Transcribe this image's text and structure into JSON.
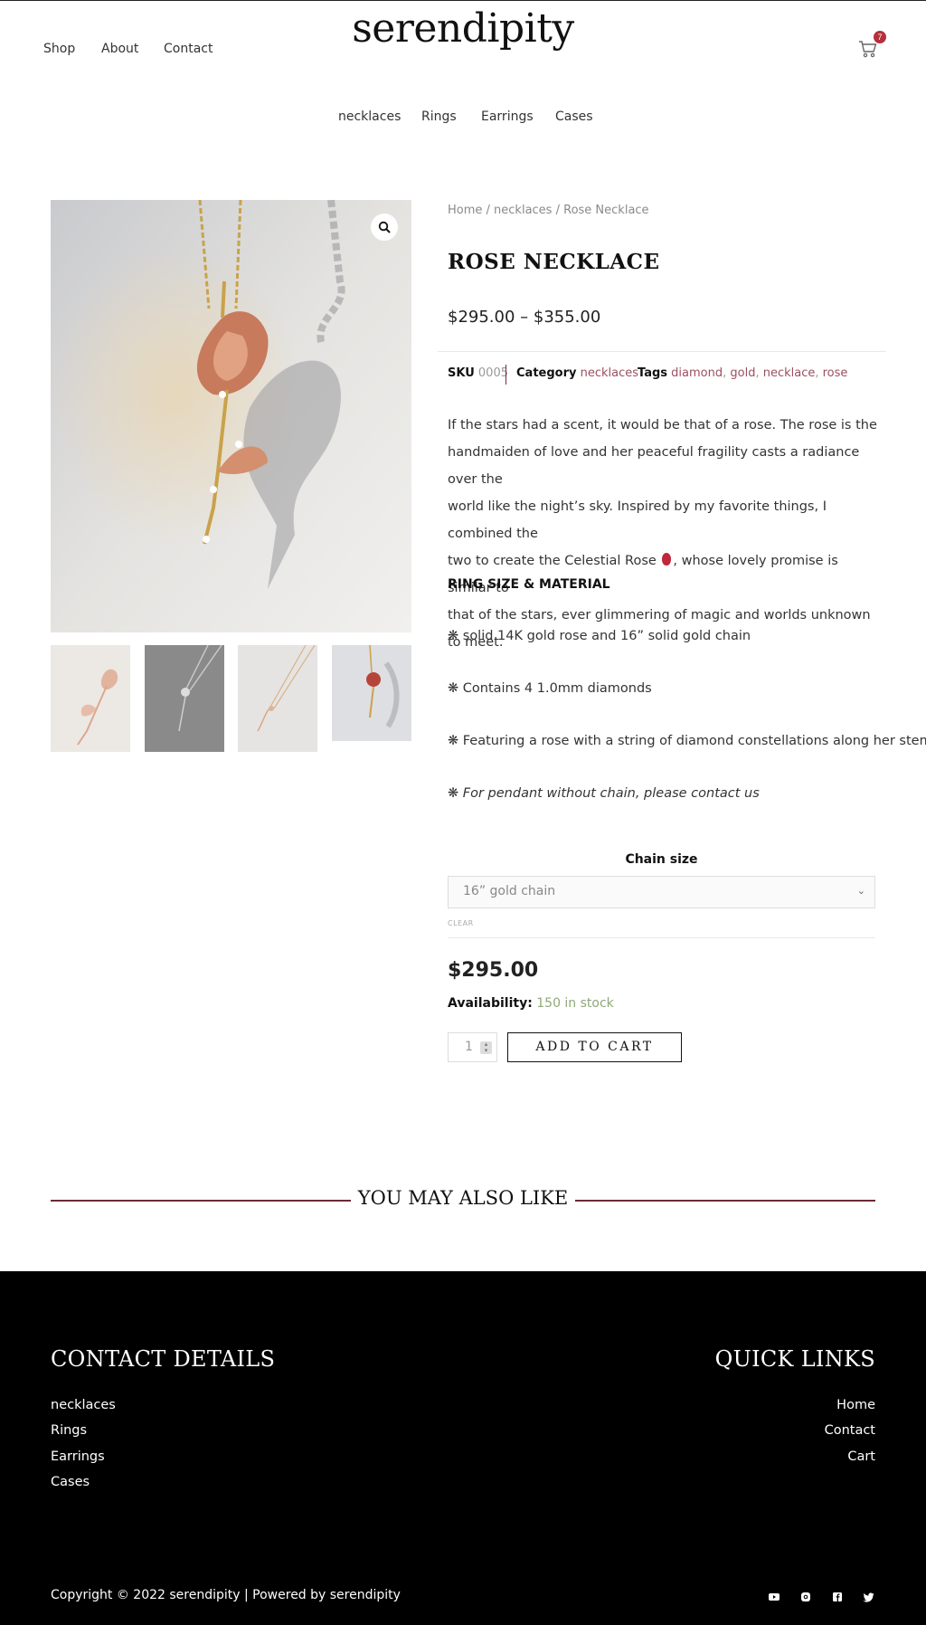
{
  "header": {
    "logo": "serendipity",
    "nav": [
      "Shop",
      "About",
      "Contact"
    ],
    "cart_count": "7",
    "categories": [
      "necklaces",
      "Rings",
      "Earrings",
      "Cases"
    ]
  },
  "breadcrumb": {
    "home": "Home",
    "sep1": " / ",
    "cat": "necklaces",
    "sep2": " / ",
    "current": "Rose Necklace"
  },
  "product": {
    "title": "ROSE NECKLACE",
    "price_range": "$295.00 – $355.00",
    "sku_label": "SKU",
    "sku": "0005",
    "category_label": "Category",
    "category": "necklaces",
    "tags_label": "Tags",
    "tags": [
      "diamond",
      "gold",
      "necklace",
      "rose"
    ],
    "description": [
      "If the stars had a scent, it would be that of a rose. The rose is the",
      "handmaiden of love and her peaceful fragility casts a radiance over the",
      "world like the night’s sky. Inspired by my favorite things, I combined the",
      "two to create the Celestial Rose",
      ", whose lovely promise is similar to",
      "that of the stars, ever glimmering of magic and worlds unknown to meet."
    ],
    "spec_heading": "RING SIZE & MATERIAL",
    "specs": [
      "❋ solid 14K gold rose and 16” solid gold chain",
      "❋ Contains 4 1.0mm diamonds",
      "❋ Featuring a rose with a string of diamond constellations along her stem"
    ],
    "spec_italic_prefix": "❋ ",
    "spec_italic": "For pendant without chain, please contact us",
    "chain_label": "Chain size",
    "chain_selected": "16” gold chain",
    "clear": "CLEAR",
    "variant_price": "$295.00",
    "availability_label": "Availability:",
    "availability": "150 in stock",
    "qty": "1",
    "add_to_cart": "ADD TO CART"
  },
  "also_like": "YOU MAY ALSO LIKE",
  "footer": {
    "contact_heading": "CONTACT DETAILS",
    "contact_links": [
      "necklaces",
      "Rings",
      "Earrings",
      "Cases"
    ],
    "quick_heading": "QUICK LINKS",
    "quick_links": [
      "Home",
      "Contact",
      "Cart"
    ],
    "copyright": "Copyright © 2022 serendipity | Powered by serendipity",
    "social_icons": [
      "youtube-icon",
      "instagram-icon",
      "facebook-icon",
      "twitter-icon"
    ]
  },
  "colors": {
    "accent": "#9b5060",
    "badge": "#b52f3c",
    "stock": "#8fa878",
    "divider": "#6b2a34"
  }
}
